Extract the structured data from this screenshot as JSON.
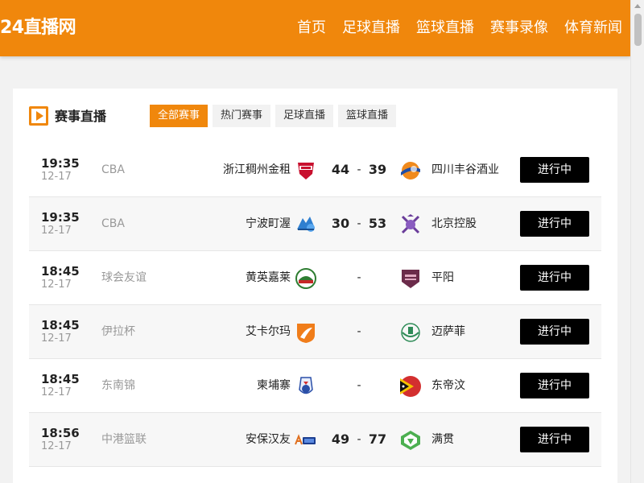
{
  "header": {
    "logo": "24直播网",
    "nav": [
      "首页",
      "足球直播",
      "篮球直播",
      "赛事录像",
      "体育新闻"
    ]
  },
  "section": {
    "title": "赛事直播",
    "tabs": [
      "全部赛事",
      "热门赛事",
      "足球直播",
      "篮球直播"
    ],
    "active_tab": 0
  },
  "matches": [
    {
      "time": "19:35",
      "date": "12-17",
      "league": "CBA",
      "home": "浙江稠州金租",
      "home_score": "44",
      "away_score": "39",
      "away": "四川丰谷酒业",
      "status": "进行中",
      "home_icon": "zhejiang-team-logo",
      "away_icon": "sichuan-team-logo"
    },
    {
      "time": "19:35",
      "date": "12-17",
      "league": "CBA",
      "home": "宁波町渥",
      "home_score": "30",
      "away_score": "53",
      "away": "北京控股",
      "status": "进行中",
      "home_icon": "ningbo-team-logo",
      "away_icon": "beijing-team-logo"
    },
    {
      "time": "18:45",
      "date": "12-17",
      "league": "球会友谊",
      "home": "黄英嘉莱",
      "home_score": "",
      "away_score": "",
      "away": "平阳",
      "status": "进行中",
      "home_icon": "hagl-team-logo",
      "away_icon": "pingyang-team-logo"
    },
    {
      "time": "18:45",
      "date": "12-17",
      "league": "伊拉杯",
      "home": "艾卡尔玛",
      "home_score": "",
      "away_score": "",
      "away": "迈萨菲",
      "status": "进行中",
      "home_icon": "akarma-team-logo",
      "away_icon": "maysafi-team-logo"
    },
    {
      "time": "18:45",
      "date": "12-17",
      "league": "东南锦",
      "home": "柬埔寨",
      "home_score": "",
      "away_score": "",
      "away": "东帝汶",
      "status": "进行中",
      "home_icon": "cambodia-team-logo",
      "away_icon": "timor-leste-flag"
    },
    {
      "time": "18:56",
      "date": "12-17",
      "league": "中港篮联",
      "home": "安保汉友",
      "home_score": "49",
      "away_score": "77",
      "away": "满贯",
      "status": "进行中",
      "home_icon": "able-team-logo",
      "away_icon": "grandslam-team-logo"
    }
  ],
  "colors": {
    "accent": "#f0870c",
    "button": "#000000"
  }
}
